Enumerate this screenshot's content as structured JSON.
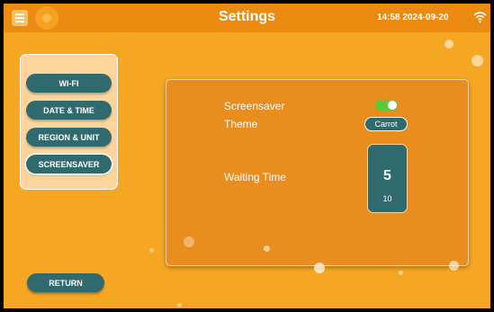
{
  "header": {
    "title": "Settings",
    "clock": "14:58 2024-09-20",
    "menu_icon": "hamburger-menu-icon",
    "sun_icon": "sun-icon",
    "wifi_icon": "wifi-icon"
  },
  "sidebar": {
    "items": [
      {
        "label": "WI-FI",
        "active": false
      },
      {
        "label": "DATE & TIME",
        "active": false
      },
      {
        "label": "REGION & UNIT",
        "active": false
      },
      {
        "label": "SCREENSAVER",
        "active": true
      }
    ]
  },
  "panel": {
    "screensaver_label": "Screensaver",
    "screensaver_enabled": true,
    "theme_label": "Theme",
    "theme_value": "Carrot",
    "waiting_label": "Waiting Time",
    "waiting_value": "5",
    "waiting_next": "10"
  },
  "return_label": "RETURN",
  "colors": {
    "background": "#f5a623",
    "header": "#ec8b10",
    "button": "#2f6a6e",
    "toggle_on": "#5cc83a"
  }
}
